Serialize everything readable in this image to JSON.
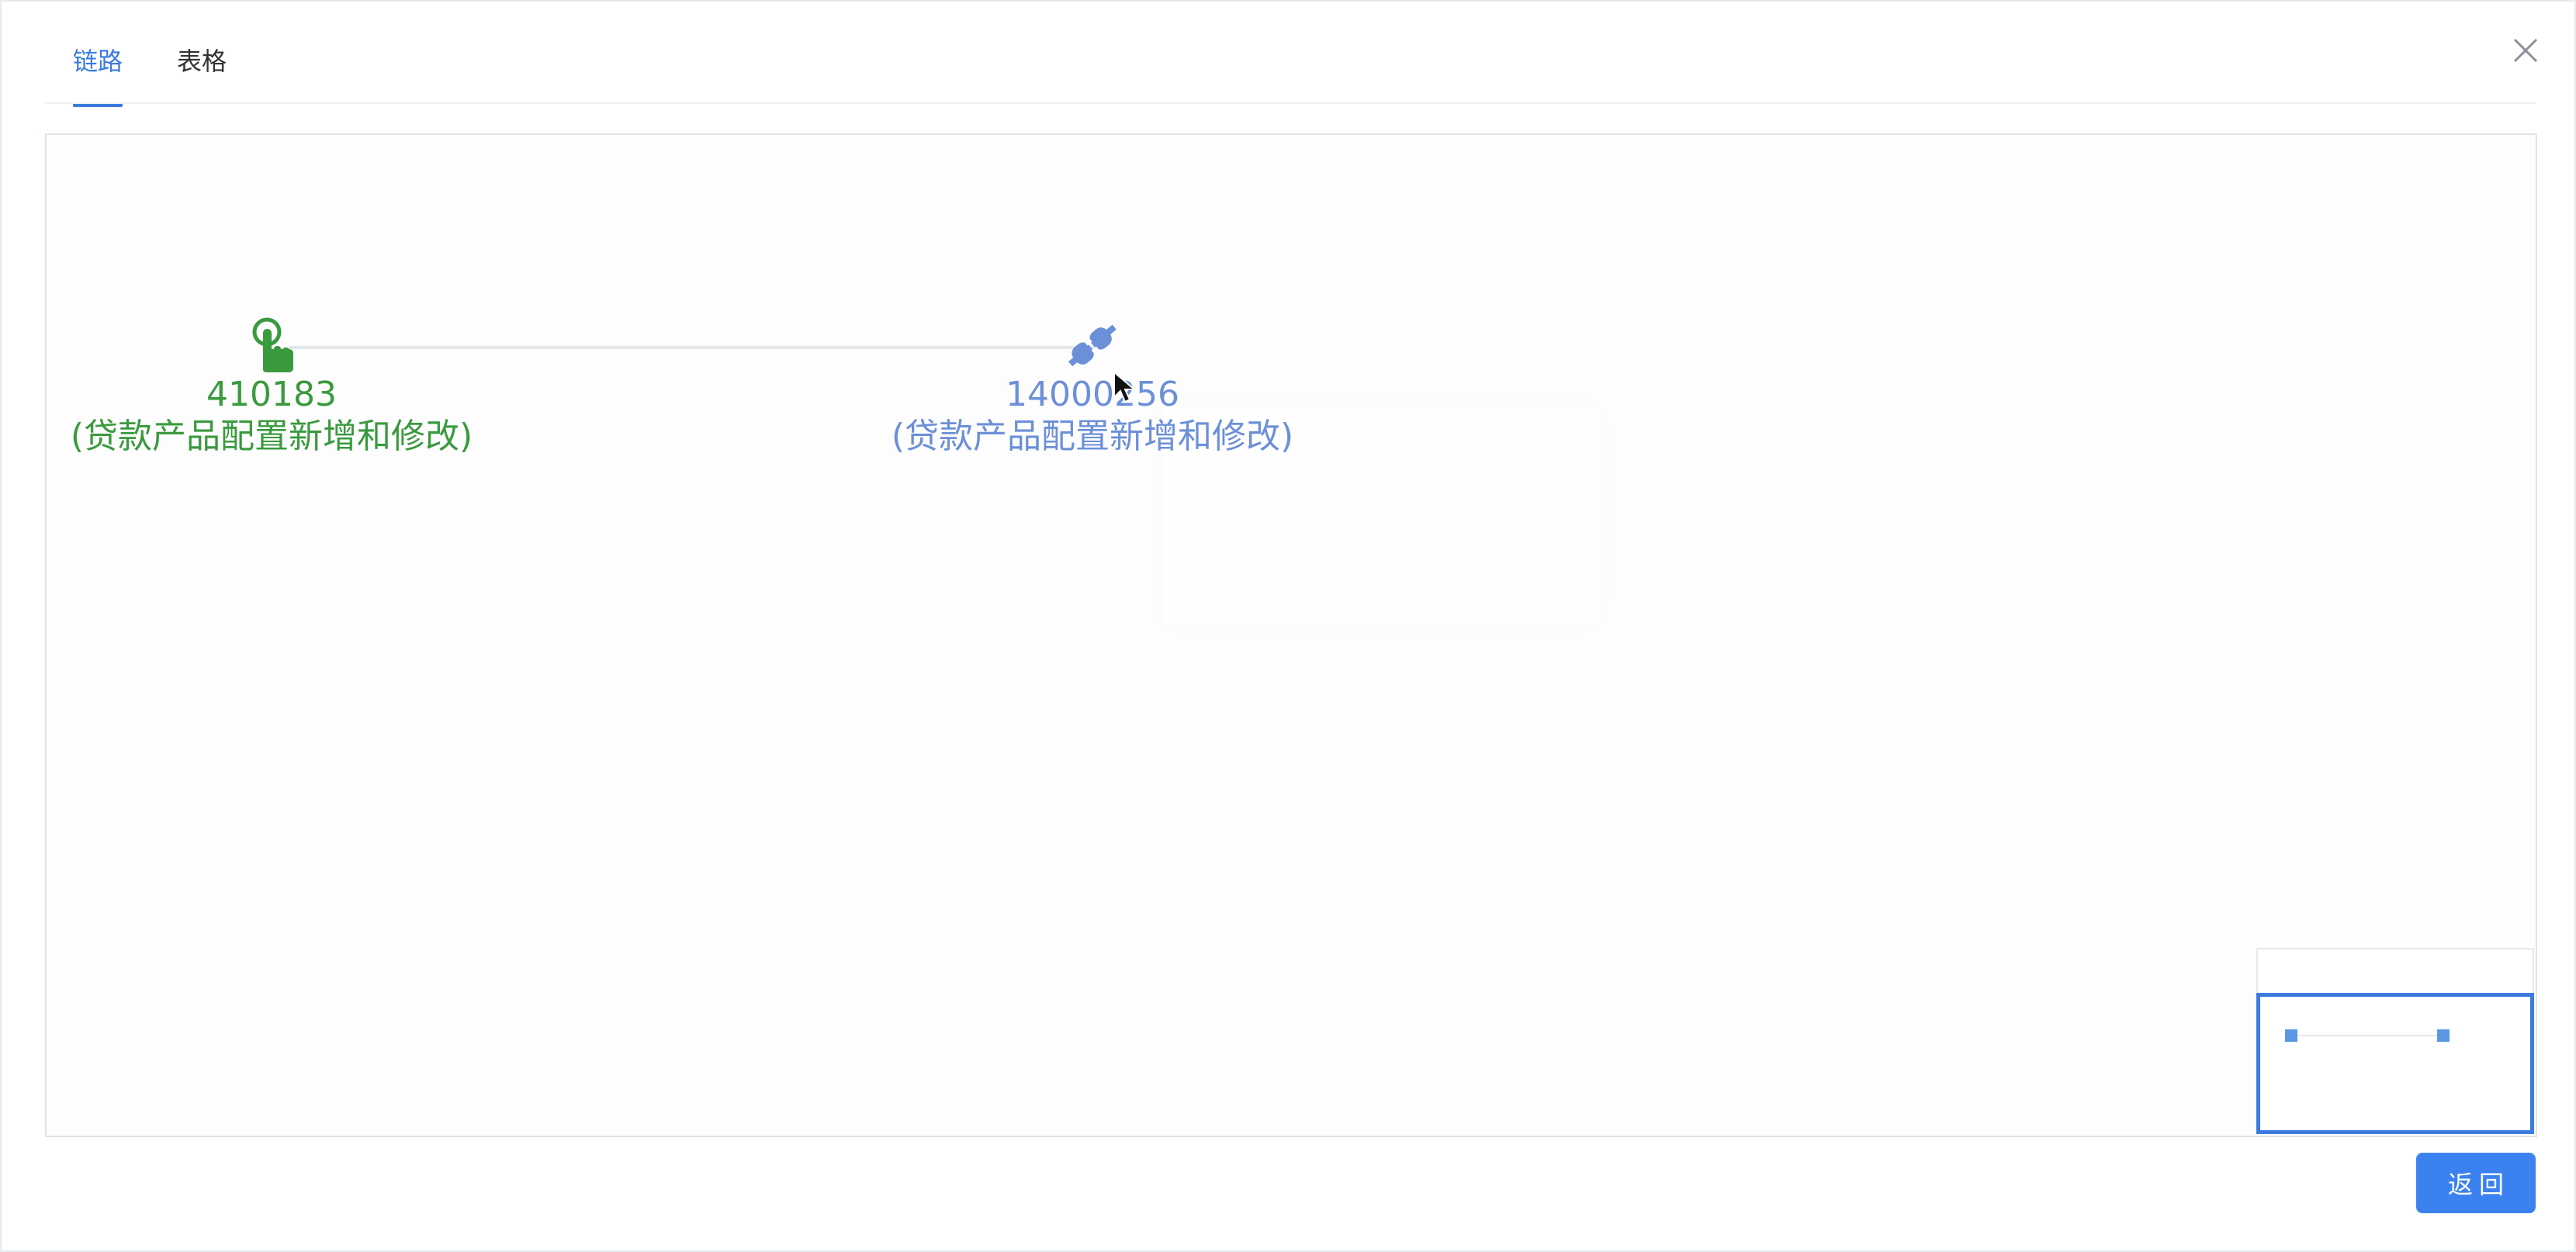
{
  "tabs": [
    {
      "label": "链路",
      "active": true
    },
    {
      "label": "表格",
      "active": false
    }
  ],
  "close_icon": "close-icon",
  "nodes": [
    {
      "id": "410183",
      "desc": "(贷款产品配置新增和修改)",
      "icon": "pointer-hand-icon",
      "color": "#3a9a3e"
    },
    {
      "id": "14000256",
      "desc": "(贷款产品配置新增和修改)",
      "icon": "plug-icon",
      "color": "#6c90d8"
    }
  ],
  "minimap": {
    "label": "minimap"
  },
  "footer": {
    "return_label": "返回"
  },
  "colors": {
    "accent": "#3b7be0",
    "button": "#3b82f0"
  }
}
